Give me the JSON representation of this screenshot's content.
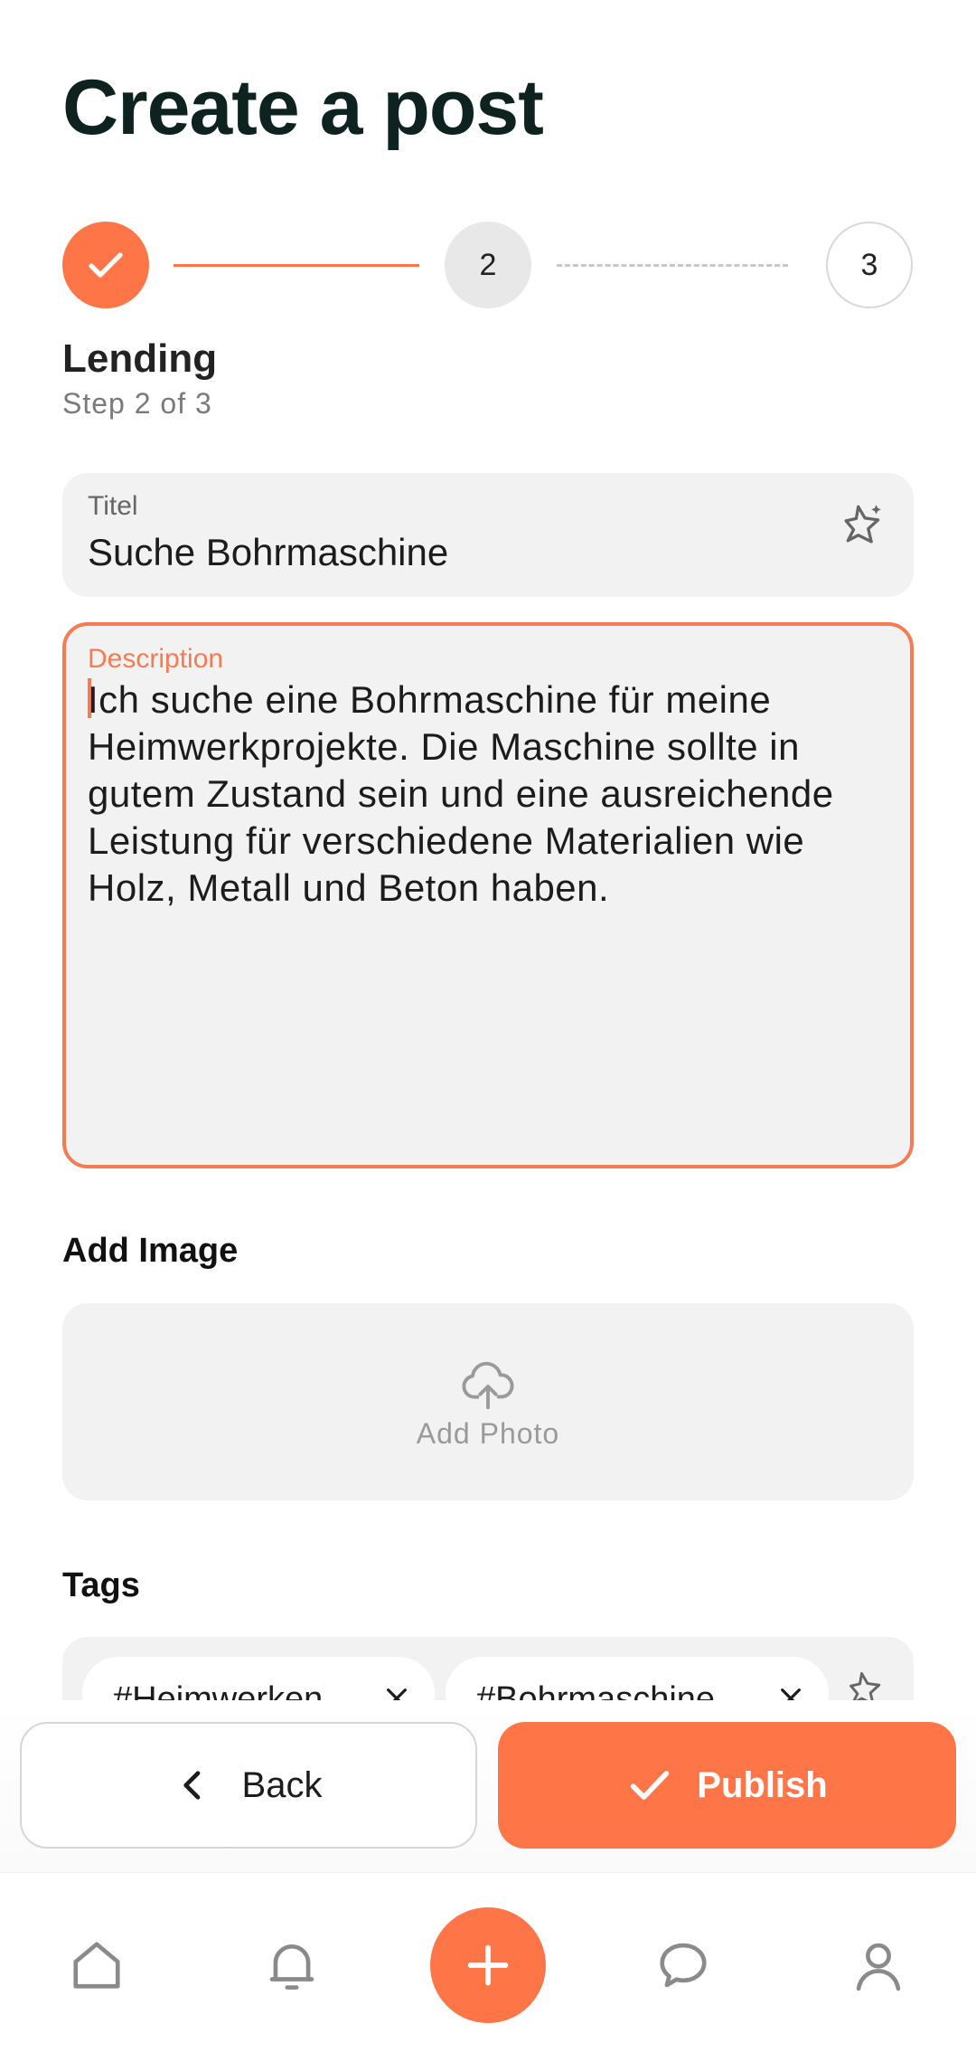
{
  "header": {
    "title": "Create a post"
  },
  "stepper": {
    "steps": [
      {
        "label": "",
        "state": "done"
      },
      {
        "label": "2",
        "state": "current"
      },
      {
        "label": "3",
        "state": "upcoming"
      }
    ],
    "current_name": "Lending",
    "progress_text": "Step 2 of 3"
  },
  "form": {
    "title": {
      "label": "Titel",
      "value": "Suche Bohrmaschine"
    },
    "description": {
      "label": "Description",
      "value": "Ich suche eine Bohrmaschine für meine Heimwerkprojekte. Die Maschine sollte in gutem Zustand sein und eine ausreichende Leistung für verschiedene Materialien wie Holz, Metall und Beton haben."
    },
    "image": {
      "section_label": "Add Image",
      "upload_label": "Add Photo"
    },
    "tags": {
      "section_label": "Tags",
      "items": [
        "#Heimwerken",
        "#Bohrmaschine"
      ]
    }
  },
  "actions": {
    "back_label": "Back",
    "publish_label": "Publish"
  },
  "nav": {
    "items": [
      "home-icon",
      "bell-icon",
      "add-icon",
      "chat-icon",
      "profile-icon"
    ]
  },
  "colors": {
    "accent": "#fe7647",
    "field_bg": "#f2f2f2",
    "title_text": "#0e2320"
  }
}
